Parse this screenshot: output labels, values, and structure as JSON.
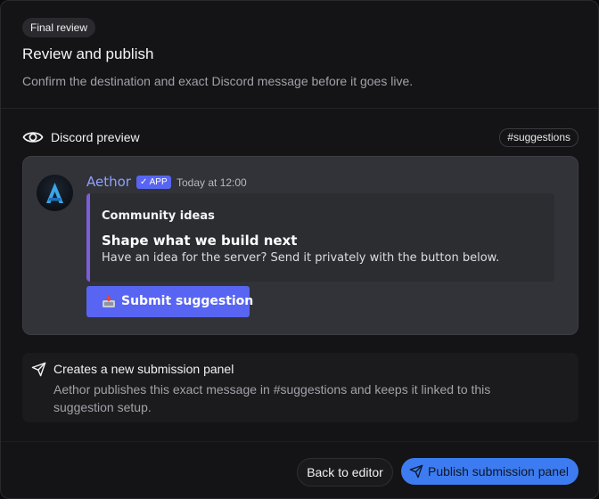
{
  "header": {
    "badge": "Final review",
    "title": "Review and publish",
    "subtitle": "Confirm the destination and exact Discord message before it goes live."
  },
  "preview_section": {
    "title": "Discord preview",
    "icon": "eye-icon",
    "channel": "#suggestions"
  },
  "message": {
    "author": "Aethor",
    "badge": "✓ APP",
    "timestamp": "Today at 12:00",
    "avatar_icon": "aethor-logo",
    "embed": {
      "author": "Community ideas",
      "title": "Shape what we build next",
      "description": "Have an idea for the server? Send it privately with the button below.",
      "accent_color": "#7c5cdb"
    },
    "button": {
      "label": "Submit suggestion",
      "icon": "inbox-tray-emoji"
    }
  },
  "info": {
    "icon": "send-icon",
    "title": "Creates a new submission panel",
    "body": "Aethor publishes this exact message in #suggestions and keeps it linked to this suggestion setup."
  },
  "footer": {
    "back_label": "Back to editor",
    "publish_label": "Publish submission panel",
    "publish_icon": "send-icon"
  },
  "colors": {
    "background": "#141416",
    "discord_blurple": "#5865f2",
    "primary_button": "#3d7cf0",
    "author_name": "#8ea1ff"
  }
}
